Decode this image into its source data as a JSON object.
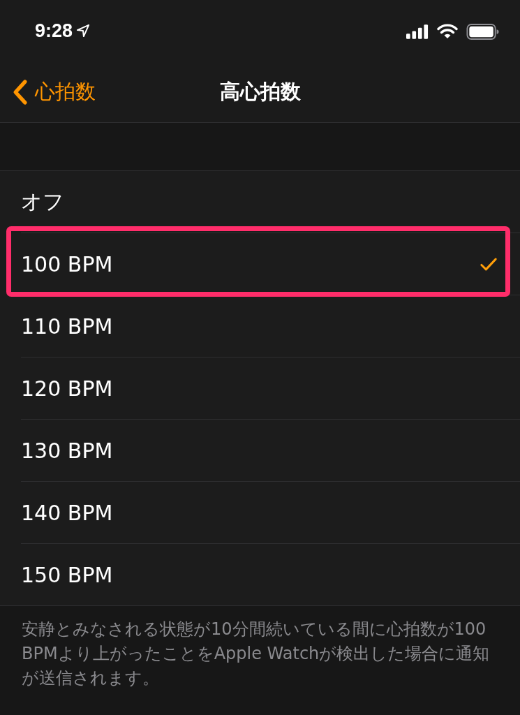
{
  "status_bar": {
    "time": "9:28"
  },
  "nav_bar": {
    "back_label": "心拍数",
    "title": "高心拍数"
  },
  "options": [
    {
      "label": "オフ",
      "selected": false,
      "highlighted": false
    },
    {
      "label": "100 BPM",
      "selected": true,
      "highlighted": true
    },
    {
      "label": "110 BPM",
      "selected": false,
      "highlighted": false
    },
    {
      "label": "120 BPM",
      "selected": false,
      "highlighted": false
    },
    {
      "label": "130 BPM",
      "selected": false,
      "highlighted": false
    },
    {
      "label": "140 BPM",
      "selected": false,
      "highlighted": false
    },
    {
      "label": "150 BPM",
      "selected": false,
      "highlighted": false
    }
  ],
  "footer": "安静とみなされる状態が10分間続いている間に心拍数が100 BPMより上がったことをApple Watchが検出した場合に通知が送信されます。"
}
